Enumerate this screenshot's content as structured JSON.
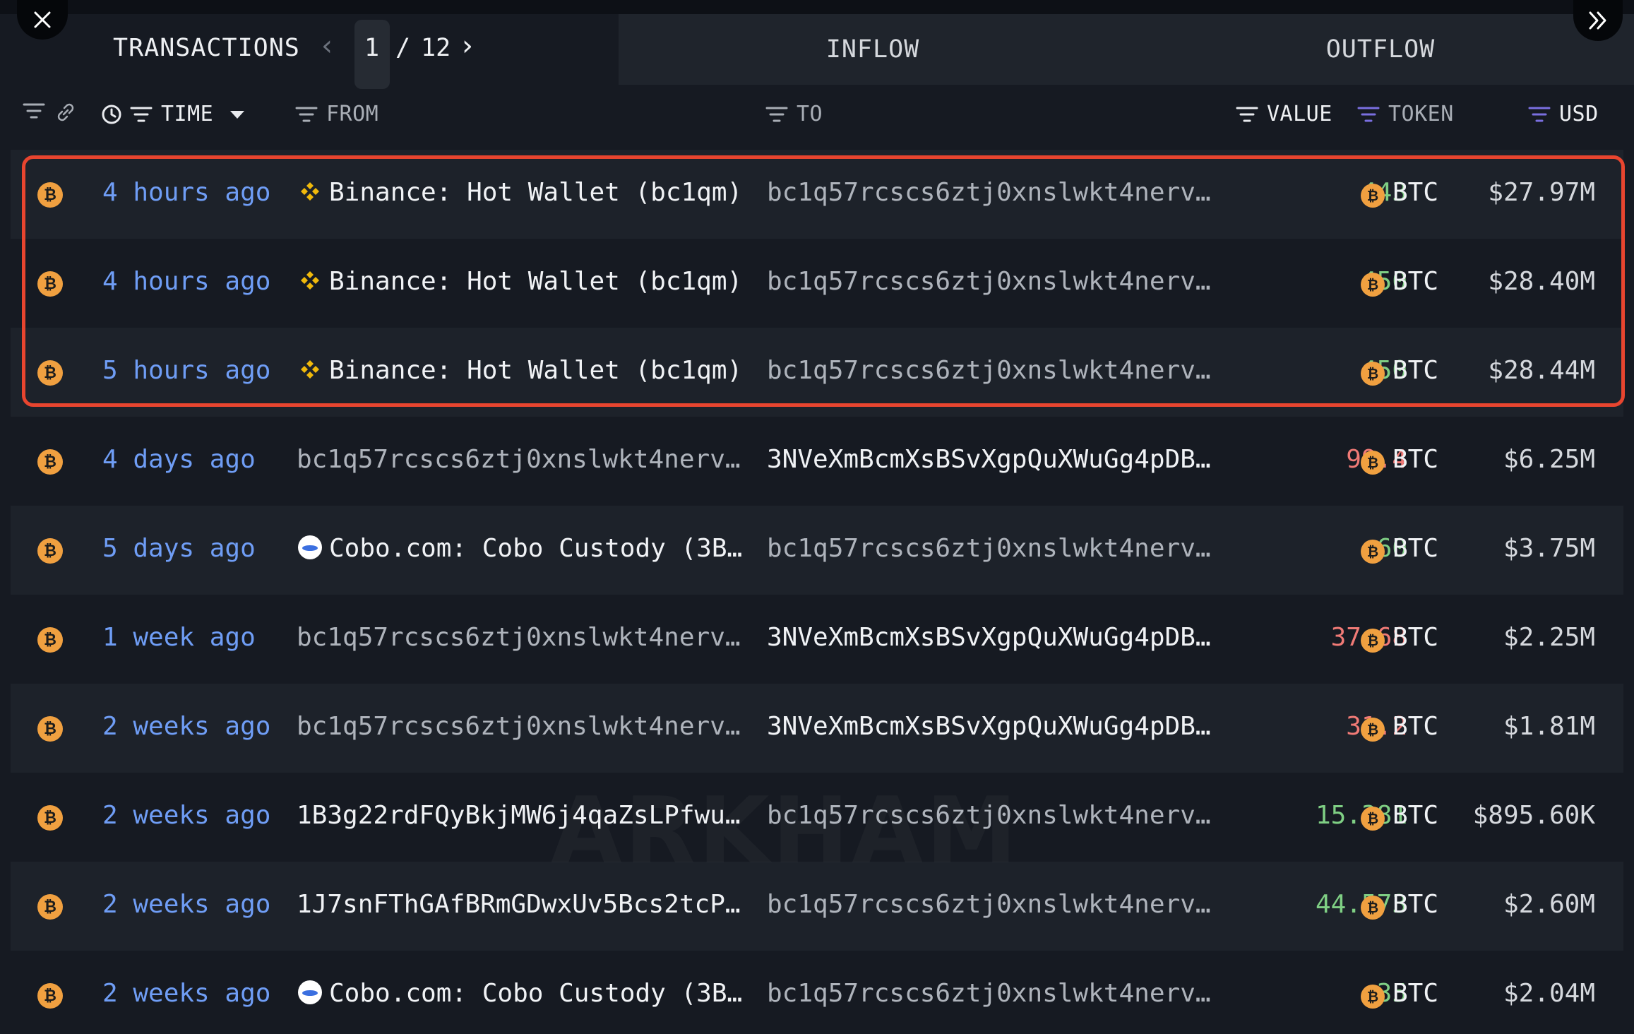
{
  "header": {
    "transactions_label": "TRANSACTIONS",
    "page": "1",
    "separator": "/",
    "total_pages": "12",
    "inflow_label": "INFLOW",
    "outflow_label": "OUTFLOW"
  },
  "columns": {
    "time": "TIME",
    "from": "FROM",
    "to": "TO",
    "value": "VALUE",
    "token": "TOKEN",
    "usd": "USD"
  },
  "colors": {
    "accent_highlight": "#e8452f",
    "time_link": "#6f9df5",
    "inflow_value": "#7fcf84",
    "outflow_value": "#f07a76",
    "btc": "#f0a040"
  },
  "rows": [
    {
      "time": "4 hours ago",
      "from": "Binance: Hot Wallet (bc1qm)",
      "to": "bc1q57rcscs6ztj0xnslwkt4nerv…",
      "value": "443",
      "token": "BTC",
      "usd": "$27.97M"
    },
    {
      "time": "4 hours ago",
      "from": "Binance: Hot Wallet (bc1qm)",
      "to": "bc1q57rcscs6ztj0xnslwkt4nerv…",
      "value": "450",
      "token": "BTC",
      "usd": "$28.40M"
    },
    {
      "time": "5 hours ago",
      "from": "Binance: Hot Wallet (bc1qm)",
      "to": "bc1q57rcscs6ztj0xnslwkt4nerv…",
      "value": "450",
      "token": "BTC",
      "usd": "$28.44M"
    },
    {
      "time": "4 days ago",
      "from": "bc1q57rcscs6ztj0xnslwkt4nerv…",
      "to": "3NVeXmBcmXsBSvXgpQuXWuGg4pDB…",
      "value": "99.4",
      "token": "BTC",
      "usd": "$6.25M"
    },
    {
      "time": "5 days ago",
      "from": "Cobo.com: Cobo Custody (3B…",
      "to": "bc1q57rcscs6ztj0xnslwkt4nerv…",
      "value": "60",
      "token": "BTC",
      "usd": "$3.75M"
    },
    {
      "time": "1 week ago",
      "from": "bc1q57rcscs6ztj0xnslwkt4nerv…",
      "to": "3NVeXmBcmXsBSvXgpQuXWuGg4pDB…",
      "value": "37.68",
      "token": "BTC",
      "usd": "$2.25M"
    },
    {
      "time": "2 weeks ago",
      "from": "bc1q57rcscs6ztj0xnslwkt4nerv…",
      "to": "3NVeXmBcmXsBSvXgpQuXWuGg4pDB…",
      "value": "31.2",
      "token": "BTC",
      "usd": "$1.81M"
    },
    {
      "time": "2 weeks ago",
      "from": "1B3g22rdFQyBkjMW6j4qaZsLPfwu…",
      "to": "bc1q57rcscs6ztj0xnslwkt4nerv…",
      "value": "15.381",
      "token": "BTC",
      "usd": "$895.60K"
    },
    {
      "time": "2 weeks ago",
      "from": "1J7snFThGAfBRmGDwxUv5Bcs2tcP…",
      "to": "bc1q57rcscs6ztj0xnslwkt4nerv…",
      "value": "44.573",
      "token": "BTC",
      "usd": "$2.60M"
    },
    {
      "time": "2 weeks ago",
      "from": "Cobo.com: Cobo Custody (3B…",
      "to": "bc1q57rcscs6ztj0xnslwkt4nerv…",
      "value": "35",
      "token": "BTC",
      "usd": "$2.04M"
    }
  ],
  "watermark": "ARKHAM"
}
